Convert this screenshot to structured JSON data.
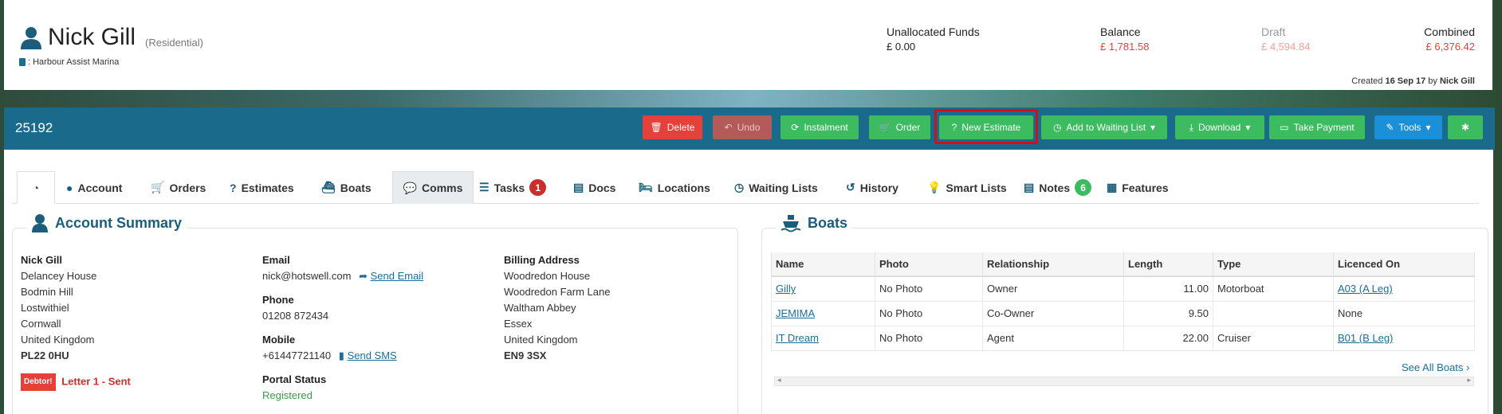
{
  "header": {
    "name": "Nick Gill",
    "type": "(Residential)",
    "marina": ": Harbour Assist Marina",
    "unallocated_label": "Unallocated Funds",
    "unallocated_value": "£ 0.00",
    "balance_label": "Balance",
    "balance_value": "£ 1,781.58",
    "draft_label": "Draft",
    "draft_value": "£ 4,594.84",
    "combined_label": "Combined",
    "combined_value": "£ 6,376.42",
    "created_prefix": "Created",
    "created_date": "16 Sep 17",
    "created_by_prefix": "by",
    "created_by": "Nick Gill"
  },
  "toolbar": {
    "account_number": "25192",
    "delete": "Delete",
    "undo": "Undo",
    "instalment": "Instalment",
    "order": "Order",
    "new_estimate": "New Estimate",
    "add_waiting_list": "Add to Waiting List",
    "download": "Download",
    "take_payment": "Take Payment",
    "tools": "Tools"
  },
  "tabs": {
    "account": "Account",
    "orders": "Orders",
    "estimates": "Estimates",
    "boats": "Boats",
    "comms": "Comms",
    "tasks": "Tasks",
    "tasks_count": "1",
    "docs": "Docs",
    "locations": "Locations",
    "waiting_lists": "Waiting Lists",
    "history": "History",
    "smart_lists": "Smart Lists",
    "notes": "Notes",
    "notes_count": "6",
    "features": "Features"
  },
  "account_summary": {
    "title": "Account Summary",
    "name": "Nick Gill",
    "address": [
      "Delancey House",
      "Bodmin Hill",
      "Lostwithiel",
      "Cornwall",
      "United Kingdom"
    ],
    "postcode": "PL22 0HU",
    "debtor_badge": "Debtor!",
    "letter_status": "Letter 1 - Sent",
    "email_label": "Email",
    "email": "nick@hotswell.com",
    "send_email": "Send Email",
    "phone_label": "Phone",
    "phone": "01208 872434",
    "mobile_label": "Mobile",
    "mobile": "+61447721140",
    "send_sms": "Send SMS",
    "portal_label": "Portal Status",
    "portal_status": "Registered",
    "billing_label": "Billing Address",
    "billing_address": [
      "Woodredon House",
      "Woodredon Farm Lane",
      "Waltham Abbey",
      "Essex",
      "United Kingdom"
    ],
    "billing_postcode": "EN9 3SX"
  },
  "boats": {
    "title": "Boats",
    "columns": [
      "Name",
      "Photo",
      "Relationship",
      "Length",
      "Type",
      "Licenced On"
    ],
    "rows": [
      {
        "name": "Gilly",
        "photo": "No Photo",
        "relationship": "Owner",
        "length": "11.00",
        "type": "Motorboat",
        "licenced": "A03 (A Leg)"
      },
      {
        "name": "JEMIMA",
        "photo": "No Photo",
        "relationship": "Co-Owner",
        "length": "9.50",
        "type": "",
        "licenced": "None"
      },
      {
        "name": "IT Dream",
        "photo": "No Photo",
        "relationship": "Agent",
        "length": "22.00",
        "type": "Cruiser",
        "licenced": "B01 (B Leg)"
      }
    ],
    "see_all": "See All Boats"
  },
  "colors": {
    "primary_bar": "#1a6a8c",
    "danger": "#e5403a",
    "success": "#3dbb61",
    "info": "#1b8fd8",
    "negative_amount": "#e5403a",
    "draft_amount": "#f2a09c"
  }
}
